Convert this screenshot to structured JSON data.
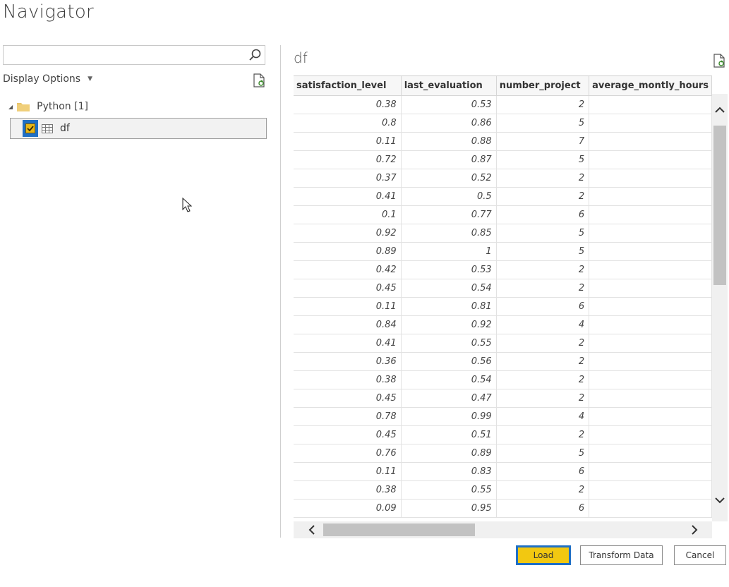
{
  "window": {
    "title": "Navigator"
  },
  "search": {
    "value": "",
    "placeholder": ""
  },
  "left_pane": {
    "display_options_label": "Display Options",
    "tree": {
      "folder_label": "Python [1]",
      "items": [
        {
          "label": "df",
          "checked": true
        }
      ]
    }
  },
  "preview": {
    "title": "df",
    "columns": [
      "satisfaction_level",
      "last_evaluation",
      "number_project",
      "average_montly_hours"
    ],
    "rows": [
      [
        "0.38",
        "0.53",
        "2",
        ""
      ],
      [
        "0.8",
        "0.86",
        "5",
        ""
      ],
      [
        "0.11",
        "0.88",
        "7",
        ""
      ],
      [
        "0.72",
        "0.87",
        "5",
        ""
      ],
      [
        "0.37",
        "0.52",
        "2",
        ""
      ],
      [
        "0.41",
        "0.5",
        "2",
        ""
      ],
      [
        "0.1",
        "0.77",
        "6",
        ""
      ],
      [
        "0.92",
        "0.85",
        "5",
        ""
      ],
      [
        "0.89",
        "1",
        "5",
        ""
      ],
      [
        "0.42",
        "0.53",
        "2",
        ""
      ],
      [
        "0.45",
        "0.54",
        "2",
        ""
      ],
      [
        "0.11",
        "0.81",
        "6",
        ""
      ],
      [
        "0.84",
        "0.92",
        "4",
        ""
      ],
      [
        "0.41",
        "0.55",
        "2",
        ""
      ],
      [
        "0.36",
        "0.56",
        "2",
        ""
      ],
      [
        "0.38",
        "0.54",
        "2",
        ""
      ],
      [
        "0.45",
        "0.47",
        "2",
        ""
      ],
      [
        "0.78",
        "0.99",
        "4",
        ""
      ],
      [
        "0.45",
        "0.51",
        "2",
        ""
      ],
      [
        "0.76",
        "0.89",
        "5",
        ""
      ],
      [
        "0.11",
        "0.83",
        "6",
        ""
      ],
      [
        "0.38",
        "0.55",
        "2",
        ""
      ],
      [
        "0.09",
        "0.95",
        "6",
        ""
      ]
    ]
  },
  "buttons": {
    "load": "Load",
    "transform": "Transform Data",
    "cancel": "Cancel"
  },
  "colors": {
    "accent_blue": "#1f6fc5",
    "load_yellow": "#f2c811",
    "checkbox_yellow": "#e8b718"
  }
}
